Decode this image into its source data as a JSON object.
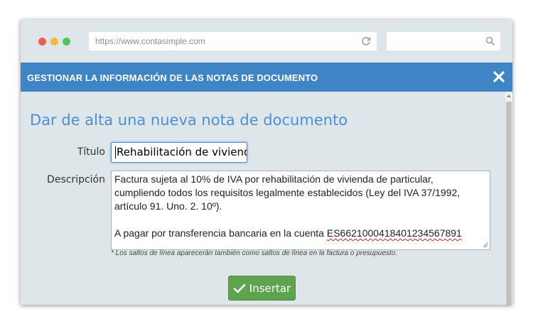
{
  "browser": {
    "url": "https://www.contasimple.com",
    "icons": {
      "reload": "reload-icon",
      "search": "search-icon"
    }
  },
  "modal": {
    "header_title": "GESTIONAR LA INFORMACIÓN DE LAS NOTAS DE DOCUMENTO",
    "close_icon": "close-icon",
    "header_color": "#3f84c4"
  },
  "form": {
    "section_title": "Dar de alta una nueva nota de documento",
    "title_label": "Título",
    "title_value": "Rehabilitación de vivienda",
    "description_label": "Descripción",
    "description_lines": [
      "Factura sujeta al 10% de IVA por rehabilitación de vivienda de particular,",
      "cumpliendo todos los requisitos legalmente establecidos (Ley del IVA 37/1992,",
      "artículo 91. Uno. 2. 10º)."
    ],
    "description_payment_prefix": "A pagar por transferencia bancaria en la cuenta ",
    "description_iban": "ES6621000418401234567891",
    "hint": "* Los saltos de línea aparecerán también como saltos de línea en la factura o presupuesto.",
    "insert_button_label": "Insertar",
    "insert_button_color": "#5ea44e",
    "accent_color": "#4a90d9"
  }
}
